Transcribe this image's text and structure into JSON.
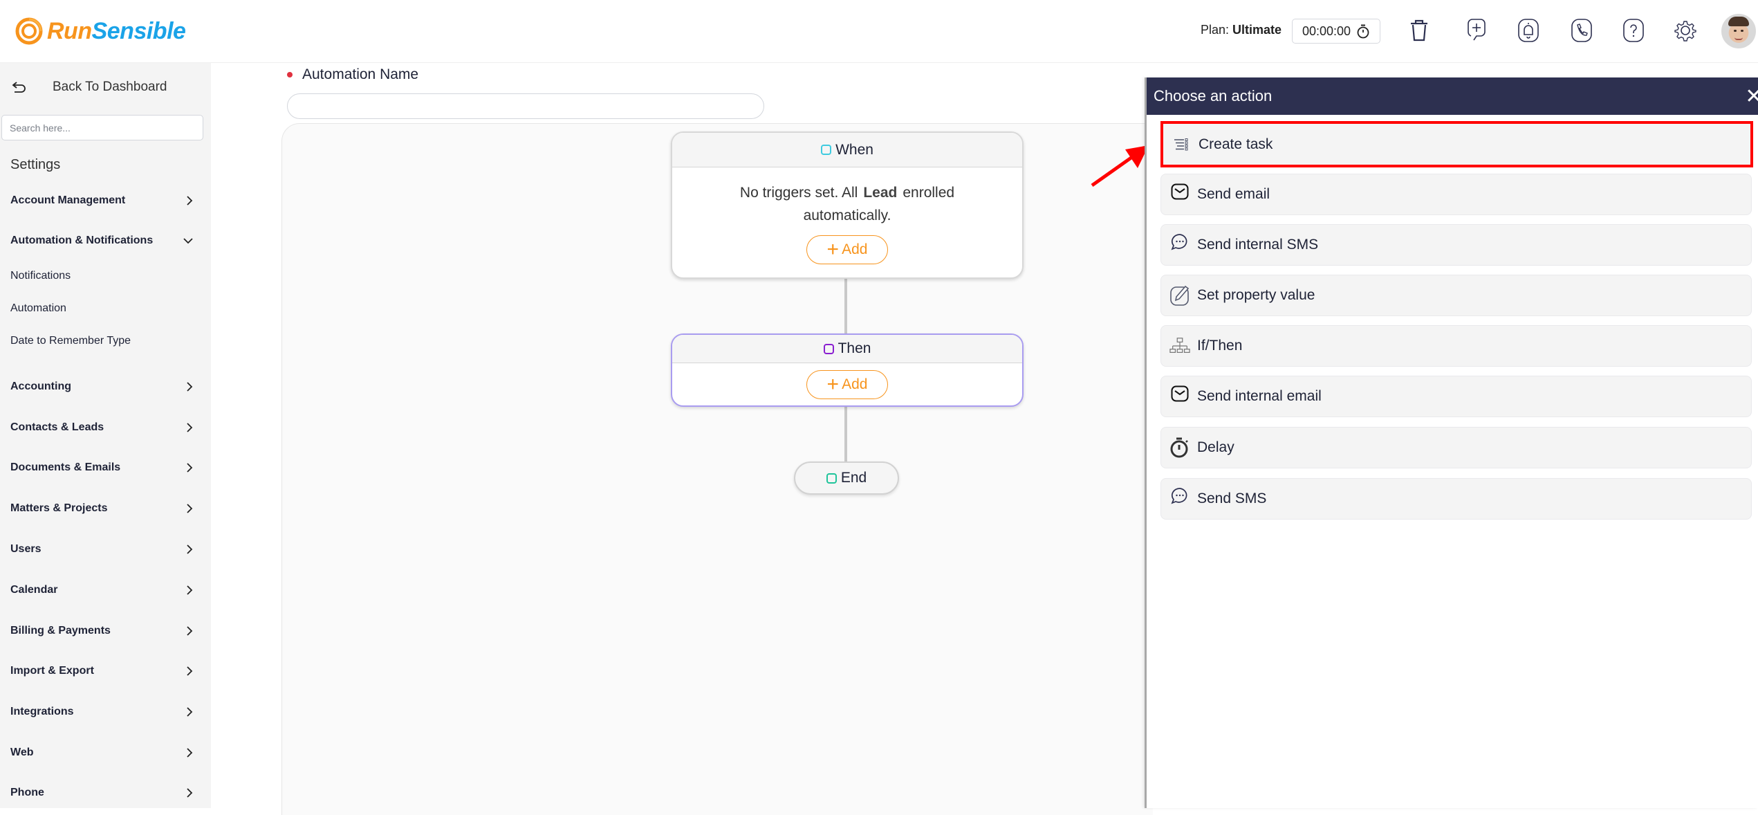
{
  "header": {
    "logo": {
      "part1": "Run",
      "part2": "Sensible"
    },
    "plan_label": "Plan:",
    "plan_value": "Ultimate",
    "timer": "00:00:00",
    "icons": [
      "trash-icon",
      "add-task-icon",
      "bell-icon",
      "phone-icon",
      "help-icon",
      "gear-icon"
    ]
  },
  "sidebar": {
    "back_label": "Back To Dashboard",
    "search_placeholder": "Search here...",
    "title": "Settings",
    "sections": [
      {
        "label": "Account Management",
        "expanded": false
      },
      {
        "label": "Automation & Notifications",
        "expanded": true,
        "children": [
          "Notifications",
          "Automation",
          "Date to Remember Type"
        ]
      },
      {
        "label": "Accounting",
        "expanded": false
      },
      {
        "label": "Contacts & Leads",
        "expanded": false
      },
      {
        "label": "Documents & Emails",
        "expanded": false
      },
      {
        "label": "Matters & Projects",
        "expanded": false
      },
      {
        "label": "Users",
        "expanded": false
      },
      {
        "label": "Calendar",
        "expanded": false
      },
      {
        "label": "Billing & Payments",
        "expanded": false
      },
      {
        "label": "Import & Export",
        "expanded": false
      },
      {
        "label": "Integrations",
        "expanded": false
      },
      {
        "label": "Web",
        "expanded": false
      },
      {
        "label": "Phone",
        "expanded": false
      }
    ]
  },
  "main": {
    "name_label": "Automation Name",
    "name_value": "",
    "when": {
      "title": "When",
      "text_before": "No triggers set. All",
      "entity": "Lead",
      "text_after": "enrolled automatically.",
      "add_label": "Add"
    },
    "then": {
      "title": "Then",
      "add_label": "Add"
    },
    "end": {
      "title": "End"
    }
  },
  "panel": {
    "title": "Choose an action",
    "close": "✕",
    "actions": [
      {
        "label": "Create task",
        "icon": "task-list-icon",
        "highlighted": true
      },
      {
        "label": "Send email",
        "icon": "mail-icon"
      },
      {
        "label": "Send internal SMS",
        "icon": "chat-bubble-icon"
      },
      {
        "label": "Set property value",
        "icon": "edit-icon"
      },
      {
        "label": "If/Then",
        "icon": "branch-icon"
      },
      {
        "label": "Send internal email",
        "icon": "mail-icon"
      },
      {
        "label": "Delay",
        "icon": "stopwatch-icon"
      },
      {
        "label": "Send SMS",
        "icon": "chat-bubble-icon"
      }
    ]
  },
  "colors": {
    "brand_orange": "#f7941d",
    "brand_blue": "#1aa3e8",
    "panel_header": "#2d3050",
    "highlight": "#ff0000",
    "when_marker": "#3fcbe0",
    "then_marker": "#8a1fd0",
    "end_marker": "#1fc49a"
  }
}
